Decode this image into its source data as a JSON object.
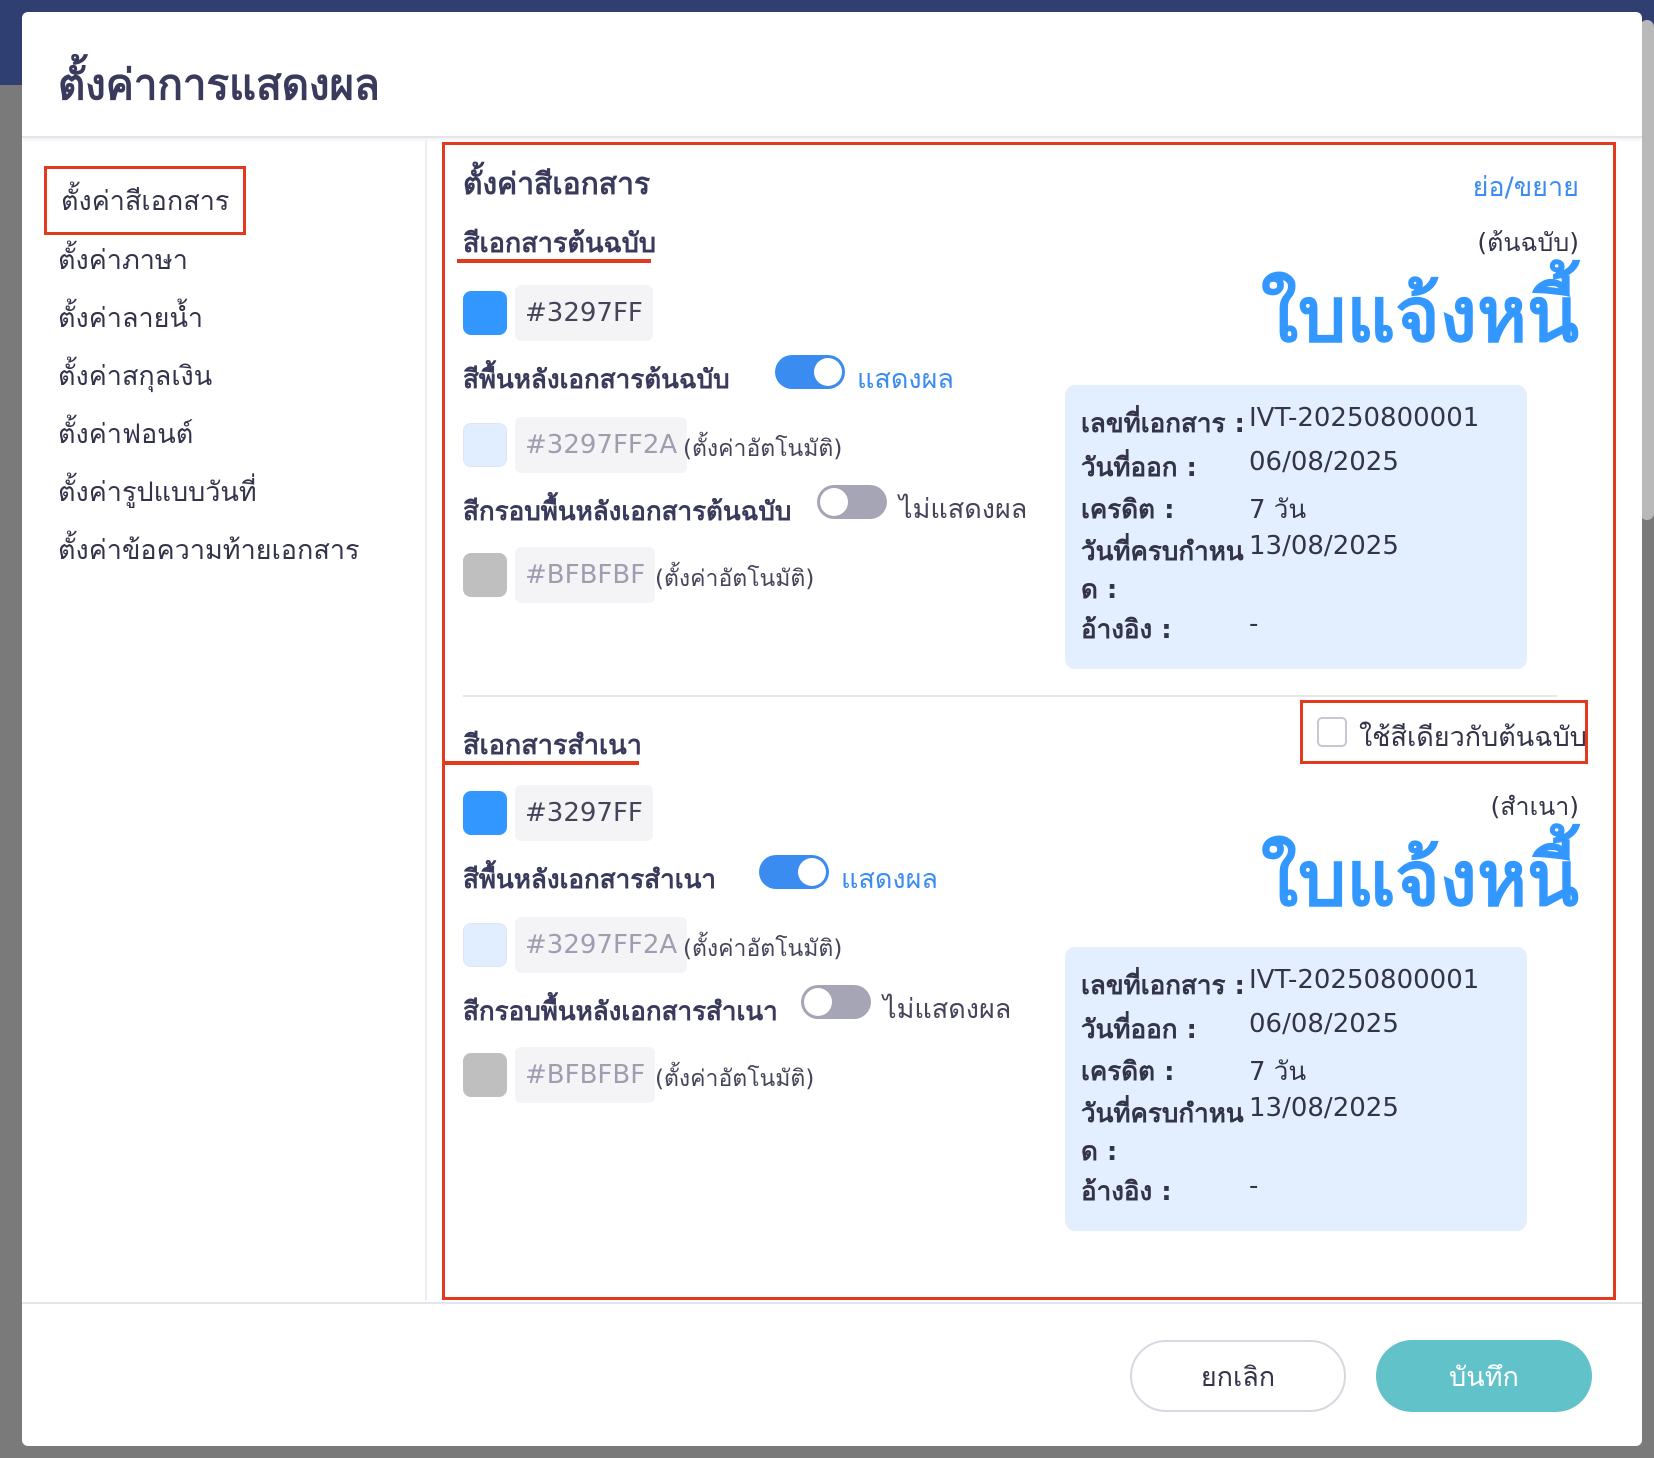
{
  "modal": {
    "title": "ตั้งค่าการแสดงผล"
  },
  "sidebar": {
    "items": [
      {
        "label": "ตั้งค่าสีเอกสาร",
        "active": true
      },
      {
        "label": "ตั้งค่าภาษา"
      },
      {
        "label": "ตั้งค่าลายน้ำ"
      },
      {
        "label": "ตั้งค่าสกุลเงิน"
      },
      {
        "label": "ตั้งค่าฟอนต์"
      },
      {
        "label": "ตั้งค่ารูปแบบวันที่"
      },
      {
        "label": "ตั้งค่าข้อความท้ายเอกสาร"
      }
    ]
  },
  "content": {
    "title": "ตั้งค่าสีเอกสาร",
    "collapse_label": "ย่อ/ขยาย",
    "original": {
      "heading": "สีเอกสารต้นฉบับ",
      "main_color": {
        "hex": "#3297FF",
        "swatch": "#3297ff"
      },
      "background": {
        "label": "สีพื้นหลังเอกสารต้นฉบับ",
        "toggle_on": true,
        "toggle_text": "แสดงผล",
        "hex": "#3297FF2A",
        "swatch": "#e1eeff",
        "auto_note": "(ตั้งค่าอัตโนมัติ)"
      },
      "border": {
        "label": "สีกรอบพื้นหลังเอกสารต้นฉบับ",
        "toggle_on": false,
        "toggle_text": "ไม่แสดงผล",
        "hex": "#BFBFBF",
        "swatch": "#bfbfbf",
        "auto_note": "(ตั้งค่าอัตโนมัติ)"
      },
      "preview": {
        "tag": "(ต้นฉบับ)",
        "doc_title": "ใบแจ้งหนี้",
        "rows": [
          {
            "label": "เลขที่เอกสาร :",
            "value": "IVT-20250800001"
          },
          {
            "label": "วันที่ออก :",
            "value": "06/08/2025"
          },
          {
            "label": "เครดิต :",
            "value": "7 วัน"
          },
          {
            "label": "วันที่ครบกำหน",
            "label2": "ด :",
            "value": "13/08/2025"
          },
          {
            "label": "อ้างอิง :",
            "value": "-"
          }
        ]
      }
    },
    "copy": {
      "heading": "สีเอกสารสำเนา",
      "same_as_original_label": "ใช้สีเดียวกับต้นฉบับ",
      "same_as_original_checked": false,
      "main_color": {
        "hex": "#3297FF",
        "swatch": "#3297ff"
      },
      "background": {
        "label": "สีพื้นหลังเอกสารสำเนา",
        "toggle_on": true,
        "toggle_text": "แสดงผล",
        "hex": "#3297FF2A",
        "swatch": "#e1eeff",
        "auto_note": "(ตั้งค่าอัตโนมัติ)"
      },
      "border": {
        "label": "สีกรอบพื้นหลังเอกสารสำเนา",
        "toggle_on": false,
        "toggle_text": "ไม่แสดงผล",
        "hex": "#BFBFBF",
        "swatch": "#bfbfbf",
        "auto_note": "(ตั้งค่าอัตโนมัติ)"
      },
      "preview": {
        "tag": "(สำเนา)",
        "doc_title": "ใบแจ้งหนี้",
        "rows": [
          {
            "label": "เลขที่เอกสาร :",
            "value": "IVT-20250800001"
          },
          {
            "label": "วันที่ออก :",
            "value": "06/08/2025"
          },
          {
            "label": "เครดิต :",
            "value": "7 วัน"
          },
          {
            "label": "วันที่ครบกำหน",
            "label2": "ด :",
            "value": "13/08/2025"
          },
          {
            "label": "อ้างอิง :",
            "value": "-"
          }
        ]
      }
    }
  },
  "footer": {
    "cancel_label": "ยกเลิก",
    "save_label": "บันทึก"
  },
  "colors": {
    "accent": "#3297ff",
    "highlight_border": "#e23a1f",
    "save_button": "#62c2c9",
    "preview_background": "#e3efff"
  }
}
